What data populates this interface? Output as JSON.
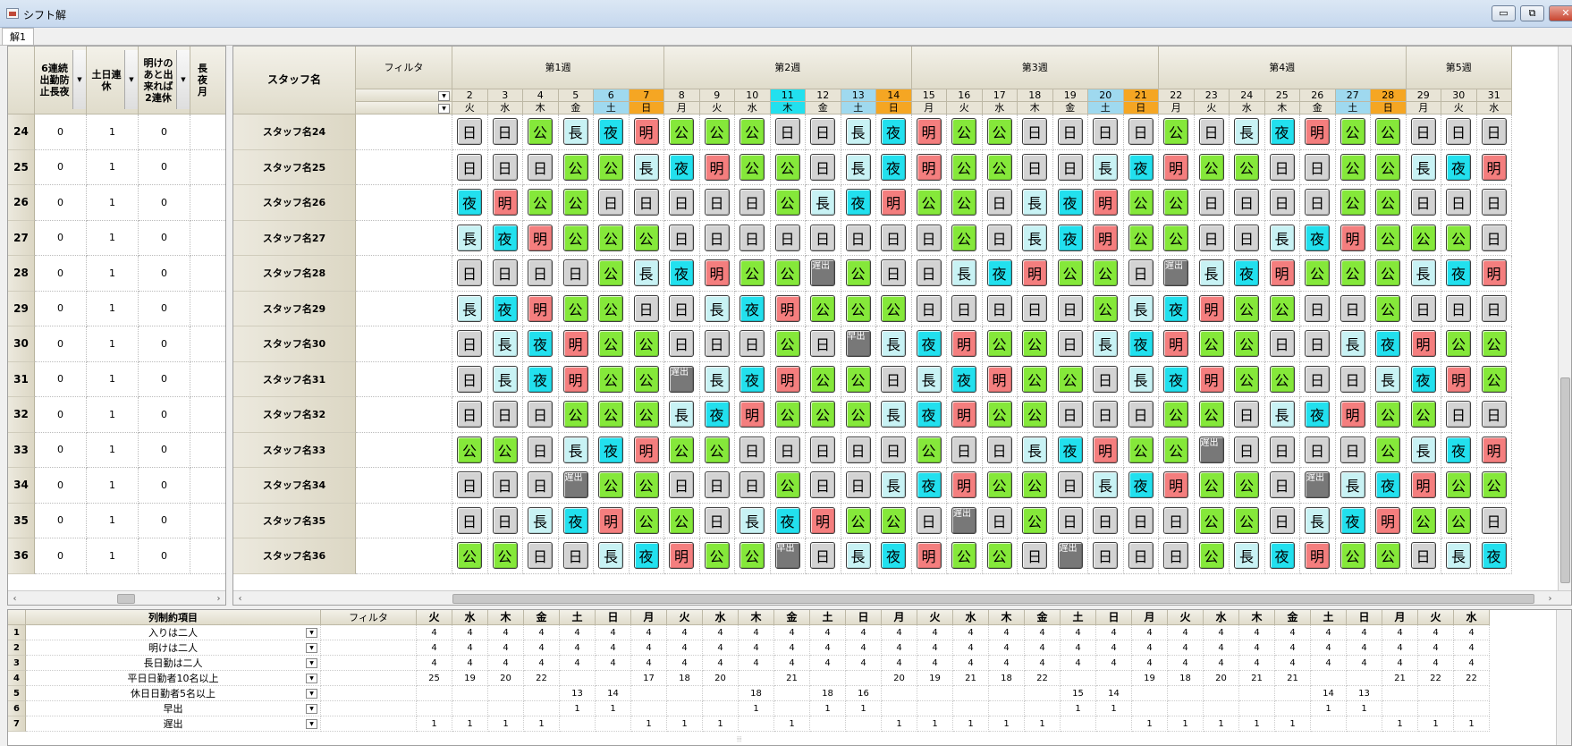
{
  "window": {
    "title": "シフト解",
    "minimize_glyph": "▭",
    "restore_glyph": "⧉",
    "close_glyph": "✕"
  },
  "tabs": [
    "解1"
  ],
  "left_grid": {
    "headers": [
      "6連続出勤防止長夜",
      "土日連休",
      "明けのあと出来れば2連休",
      "長夜月"
    ],
    "rows": [
      {
        "num": "24",
        "vals": [
          "0",
          "1",
          "0"
        ]
      },
      {
        "num": "25",
        "vals": [
          "0",
          "1",
          "0"
        ]
      },
      {
        "num": "26",
        "vals": [
          "0",
          "1",
          "0"
        ]
      },
      {
        "num": "27",
        "vals": [
          "0",
          "1",
          "0"
        ]
      },
      {
        "num": "28",
        "vals": [
          "0",
          "1",
          "0"
        ]
      },
      {
        "num": "29",
        "vals": [
          "0",
          "1",
          "0"
        ]
      },
      {
        "num": "30",
        "vals": [
          "0",
          "1",
          "0"
        ]
      },
      {
        "num": "31",
        "vals": [
          "0",
          "1",
          "0"
        ]
      },
      {
        "num": "32",
        "vals": [
          "0",
          "1",
          "0"
        ]
      },
      {
        "num": "33",
        "vals": [
          "0",
          "1",
          "0"
        ]
      },
      {
        "num": "34",
        "vals": [
          "0",
          "1",
          "0"
        ]
      },
      {
        "num": "35",
        "vals": [
          "0",
          "1",
          "0"
        ]
      },
      {
        "num": "36",
        "vals": [
          "0",
          "1",
          "0"
        ]
      }
    ]
  },
  "main_grid": {
    "staff_header": "スタッフ名",
    "filter_header": "フィルタ",
    "weeks": [
      "第1週",
      "第2週",
      "第3週",
      "第4週",
      "第5週"
    ],
    "days": [
      {
        "d": "2",
        "w": "火",
        "t": "n"
      },
      {
        "d": "3",
        "w": "水",
        "t": "n"
      },
      {
        "d": "4",
        "w": "木",
        "t": "n"
      },
      {
        "d": "5",
        "w": "金",
        "t": "n"
      },
      {
        "d": "6",
        "w": "土",
        "t": "sat"
      },
      {
        "d": "7",
        "w": "日",
        "t": "sun"
      },
      {
        "d": "8",
        "w": "月",
        "t": "n"
      },
      {
        "d": "9",
        "w": "火",
        "t": "n"
      },
      {
        "d": "10",
        "w": "水",
        "t": "n"
      },
      {
        "d": "11",
        "w": "木",
        "t": "hol"
      },
      {
        "d": "12",
        "w": "金",
        "t": "n"
      },
      {
        "d": "13",
        "w": "土",
        "t": "sat"
      },
      {
        "d": "14",
        "w": "日",
        "t": "sun"
      },
      {
        "d": "15",
        "w": "月",
        "t": "n"
      },
      {
        "d": "16",
        "w": "火",
        "t": "n"
      },
      {
        "d": "17",
        "w": "水",
        "t": "n"
      },
      {
        "d": "18",
        "w": "木",
        "t": "n"
      },
      {
        "d": "19",
        "w": "金",
        "t": "n"
      },
      {
        "d": "20",
        "w": "土",
        "t": "sat"
      },
      {
        "d": "21",
        "w": "日",
        "t": "sun"
      },
      {
        "d": "22",
        "w": "月",
        "t": "n"
      },
      {
        "d": "23",
        "w": "火",
        "t": "n"
      },
      {
        "d": "24",
        "w": "水",
        "t": "n"
      },
      {
        "d": "25",
        "w": "木",
        "t": "n"
      },
      {
        "d": "26",
        "w": "金",
        "t": "n"
      },
      {
        "d": "27",
        "w": "土",
        "t": "sat"
      },
      {
        "d": "28",
        "w": "日",
        "t": "sun"
      },
      {
        "d": "29",
        "w": "月",
        "t": "n"
      },
      {
        "d": "30",
        "w": "火",
        "t": "n"
      },
      {
        "d": "31",
        "w": "水",
        "t": "n"
      }
    ],
    "staff": [
      {
        "name": "スタッフ名24",
        "shifts": [
          "日",
          "日",
          "公",
          "長",
          "夜",
          "明",
          "公",
          "公",
          "公",
          "日",
          "日",
          "長",
          "夜",
          "明",
          "公",
          "公",
          "日",
          "日",
          "日",
          "日",
          "公",
          "日",
          "長",
          "夜",
          "明",
          "公",
          "公",
          "日",
          "日",
          "日"
        ]
      },
      {
        "name": "スタッフ名25",
        "shifts": [
          "日",
          "日",
          "日",
          "公",
          "公",
          "長",
          "夜",
          "明",
          "公",
          "公",
          "日",
          "長",
          "夜",
          "明",
          "公",
          "公",
          "日",
          "日",
          "長",
          "夜",
          "明",
          "公",
          "公",
          "日",
          "日",
          "公",
          "公",
          "長",
          "夜",
          "明"
        ]
      },
      {
        "name": "スタッフ名26",
        "shifts": [
          "夜",
          "明",
          "公",
          "公",
          "日",
          "日",
          "日",
          "日",
          "日",
          "公",
          "長",
          "夜",
          "明",
          "公",
          "公",
          "日",
          "長",
          "夜",
          "明",
          "公",
          "公",
          "日",
          "日",
          "日",
          "日",
          "公",
          "公",
          "日",
          "日",
          "日"
        ]
      },
      {
        "name": "スタッフ名27",
        "shifts": [
          "長",
          "夜",
          "明",
          "公",
          "公",
          "公",
          "日",
          "日",
          "日",
          "日",
          "日",
          "日",
          "日",
          "日",
          "公",
          "日",
          "長",
          "夜",
          "明",
          "公",
          "公",
          "日",
          "日",
          "長",
          "夜",
          "明",
          "公",
          "公",
          "公",
          "日"
        ]
      },
      {
        "name": "スタッフ名28",
        "shifts": [
          "日",
          "日",
          "日",
          "日",
          "公",
          "長",
          "夜",
          "明",
          "公",
          "公",
          "遅出",
          "公",
          "日",
          "日",
          "長",
          "夜",
          "明",
          "公",
          "公",
          "日",
          "遅出",
          "長",
          "夜",
          "明",
          "公",
          "公",
          "公",
          "長",
          "夜",
          "明"
        ]
      },
      {
        "name": "スタッフ名29",
        "shifts": [
          "長",
          "夜",
          "明",
          "公",
          "公",
          "日",
          "日",
          "長",
          "夜",
          "明",
          "公",
          "公",
          "公",
          "日",
          "日",
          "日",
          "日",
          "日",
          "公",
          "長",
          "夜",
          "明",
          "公",
          "公",
          "日",
          "日",
          "公",
          "日",
          "日",
          "日"
        ]
      },
      {
        "name": "スタッフ名30",
        "shifts": [
          "日",
          "長",
          "夜",
          "明",
          "公",
          "公",
          "日",
          "日",
          "日",
          "公",
          "日",
          "早出",
          "長",
          "夜",
          "明",
          "公",
          "公",
          "日",
          "長",
          "夜",
          "明",
          "公",
          "公",
          "日",
          "日",
          "長",
          "夜",
          "明",
          "公",
          "公"
        ]
      },
      {
        "name": "スタッフ名31",
        "shifts": [
          "日",
          "長",
          "夜",
          "明",
          "公",
          "公",
          "遅出",
          "長",
          "夜",
          "明",
          "公",
          "公",
          "日",
          "長",
          "夜",
          "明",
          "公",
          "公",
          "日",
          "長",
          "夜",
          "明",
          "公",
          "公",
          "日",
          "日",
          "長",
          "夜",
          "明",
          "公"
        ]
      },
      {
        "name": "スタッフ名32",
        "shifts": [
          "日",
          "日",
          "日",
          "公",
          "公",
          "公",
          "長",
          "夜",
          "明",
          "公",
          "公",
          "公",
          "長",
          "夜",
          "明",
          "公",
          "公",
          "日",
          "日",
          "日",
          "公",
          "公",
          "日",
          "長",
          "夜",
          "明",
          "公",
          "公",
          "日",
          "日"
        ]
      },
      {
        "name": "スタッフ名33",
        "shifts": [
          "公",
          "公",
          "日",
          "長",
          "夜",
          "明",
          "公",
          "公",
          "日",
          "日",
          "日",
          "日",
          "日",
          "公",
          "日",
          "日",
          "長",
          "夜",
          "明",
          "公",
          "公",
          "遅出",
          "日",
          "日",
          "日",
          "日",
          "公",
          "長",
          "夜",
          "明"
        ]
      },
      {
        "name": "スタッフ名34",
        "shifts": [
          "日",
          "日",
          "日",
          "遅出",
          "公",
          "公",
          "日",
          "日",
          "日",
          "公",
          "日",
          "日",
          "長",
          "夜",
          "明",
          "公",
          "公",
          "日",
          "長",
          "夜",
          "明",
          "公",
          "公",
          "日",
          "遅出",
          "長",
          "夜",
          "明",
          "公",
          "公"
        ]
      },
      {
        "name": "スタッフ名35",
        "shifts": [
          "日",
          "日",
          "長",
          "夜",
          "明",
          "公",
          "公",
          "日",
          "長",
          "夜",
          "明",
          "公",
          "公",
          "日",
          "遅出",
          "日",
          "公",
          "日",
          "日",
          "日",
          "日",
          "公",
          "公",
          "日",
          "長",
          "夜",
          "明",
          "公",
          "公",
          "日"
        ]
      },
      {
        "name": "スタッフ名36",
        "shifts": [
          "公",
          "公",
          "日",
          "日",
          "長",
          "夜",
          "明",
          "公",
          "公",
          "早出",
          "日",
          "長",
          "夜",
          "明",
          "公",
          "公",
          "日",
          "遅出",
          "日",
          "日",
          "日",
          "公",
          "長",
          "夜",
          "明",
          "公",
          "公",
          "日",
          "長",
          "夜"
        ]
      }
    ]
  },
  "bottom_grid": {
    "header": "列制約項目",
    "filter_header": "フィルタ",
    "rows": [
      {
        "num": "1",
        "label": "入りは二人",
        "vals": [
          "4",
          "4",
          "4",
          "4",
          "4",
          "4",
          "4",
          "4",
          "4",
          "4",
          "4",
          "4",
          "4",
          "4",
          "4",
          "4",
          "4",
          "4",
          "4",
          "4",
          "4",
          "4",
          "4",
          "4",
          "4",
          "4",
          "4",
          "4",
          "4",
          "4"
        ]
      },
      {
        "num": "2",
        "label": "明けは二人",
        "vals": [
          "4",
          "4",
          "4",
          "4",
          "4",
          "4",
          "4",
          "4",
          "4",
          "4",
          "4",
          "4",
          "4",
          "4",
          "4",
          "4",
          "4",
          "4",
          "4",
          "4",
          "4",
          "4",
          "4",
          "4",
          "4",
          "4",
          "4",
          "4",
          "4",
          "4"
        ]
      },
      {
        "num": "3",
        "label": "長日勤は二人",
        "vals": [
          "4",
          "4",
          "4",
          "4",
          "4",
          "4",
          "4",
          "4",
          "4",
          "4",
          "4",
          "4",
          "4",
          "4",
          "4",
          "4",
          "4",
          "4",
          "4",
          "4",
          "4",
          "4",
          "4",
          "4",
          "4",
          "4",
          "4",
          "4",
          "4",
          "4"
        ]
      },
      {
        "num": "4",
        "label": "平日日勤者10名以上",
        "vals": [
          "25",
          "19",
          "20",
          "22",
          "",
          "",
          "17",
          "18",
          "20",
          "",
          "21",
          "",
          "",
          "20",
          "19",
          "21",
          "18",
          "22",
          "",
          "",
          "19",
          "18",
          "20",
          "21",
          "21",
          "",
          "",
          "21",
          "22",
          "22"
        ]
      },
      {
        "num": "5",
        "label": "休日日勤者5名以上",
        "vals": [
          "",
          "",
          "",
          "",
          "13",
          "14",
          "",
          "",
          "",
          "18",
          "",
          "18",
          "16",
          "",
          "",
          "",
          "",
          "",
          "15",
          "14",
          "",
          "",
          "",
          "",
          "",
          "14",
          "13",
          "",
          "",
          ""
        ]
      },
      {
        "num": "6",
        "label": "早出",
        "vals": [
          "",
          "",
          "",
          "",
          "1",
          "1",
          "",
          "",
          "",
          "1",
          "",
          "1",
          "1",
          "",
          "",
          "",
          "",
          "",
          "1",
          "1",
          "",
          "",
          "",
          "",
          "",
          "1",
          "1",
          "",
          "",
          ""
        ]
      },
      {
        "num": "7",
        "label": "遅出",
        "vals": [
          "1",
          "1",
          "1",
          "1",
          "",
          "",
          "1",
          "1",
          "1",
          "",
          "1",
          "",
          "",
          "1",
          "1",
          "1",
          "1",
          "1",
          "",
          "",
          "1",
          "1",
          "1",
          "1",
          "1",
          "",
          "",
          "1",
          "1",
          "1"
        ]
      }
    ]
  },
  "colors": {
    "公": "#85e83a",
    "日": "#d3d3d3",
    "長": "#c8f2f4",
    "夜": "#22e0ee",
    "明": "#f47e7e",
    "遅出": "#787878",
    "早出": "#787878",
    "sat": "#9fd9ef",
    "sun": "#f5a623",
    "hol": "#22e0ee",
    "n": "#e8e4d6"
  },
  "icons": {
    "dropdown": "chevron-down-icon",
    "scroll_left": "arrow-left-icon",
    "scroll_right": "arrow-right-icon"
  },
  "glyphs": {
    "dropdown": "▼",
    "left": "‹",
    "right": "›",
    "grip": "⦙⦙⦙"
  }
}
